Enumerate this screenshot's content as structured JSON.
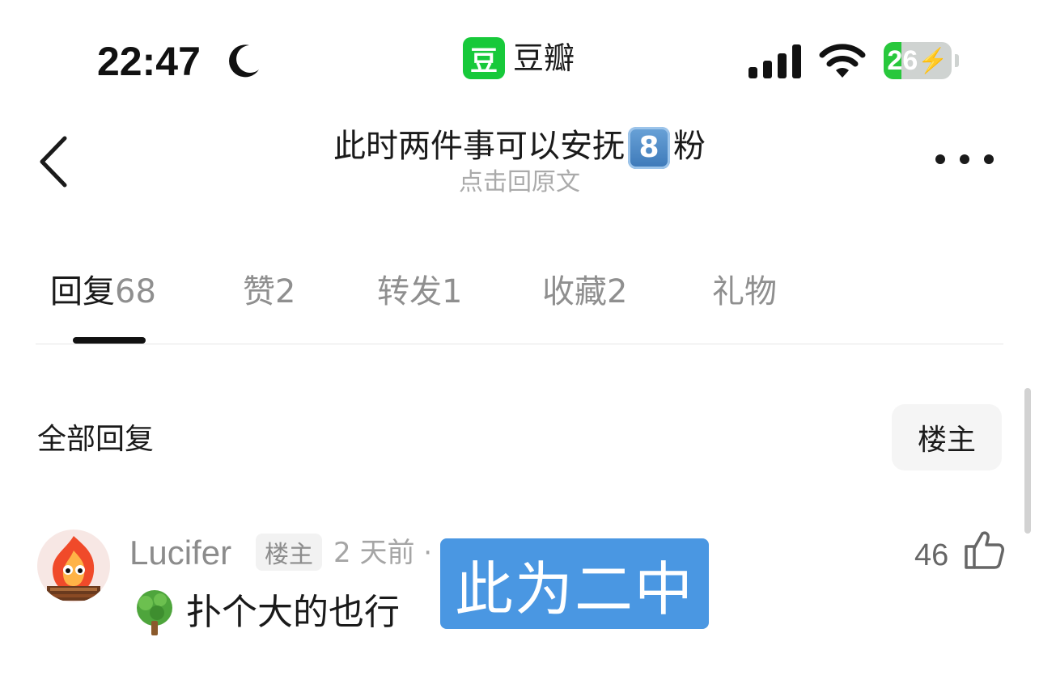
{
  "status_bar": {
    "time": "22:47",
    "app_name": "豆瓣",
    "app_badge": "豆",
    "battery_level": "26",
    "battery_fraction": 0.26,
    "focus_icon": "moon-icon",
    "colors": {
      "app_green": "#17c93a",
      "battery_green": "#28c83c"
    }
  },
  "header": {
    "title_before": "此时两件事可以安抚",
    "title_keycap": "8",
    "title_after": "粉",
    "subtitle": "点击回原文",
    "back_icon": "chevron-left-icon",
    "more_icon": "more-dots-icon"
  },
  "tabs": [
    {
      "label": "回复",
      "count": "68",
      "active": true
    },
    {
      "label": "赞",
      "count": "2"
    },
    {
      "label": "转发",
      "count": "1"
    },
    {
      "label": "收藏",
      "count": "2"
    },
    {
      "label": "礼物",
      "count": ""
    }
  ],
  "replies": {
    "section_title": "全部回复",
    "filter_label": "楼主",
    "comments": [
      {
        "username": "Lucifer",
        "badge": "楼主",
        "time": "2 天前 · ",
        "text": "扑个大的也行",
        "emoji": "tree-icon",
        "likes": "46",
        "overlay_label": "此为二中",
        "overlay_color": "#4a97e2"
      }
    ]
  }
}
